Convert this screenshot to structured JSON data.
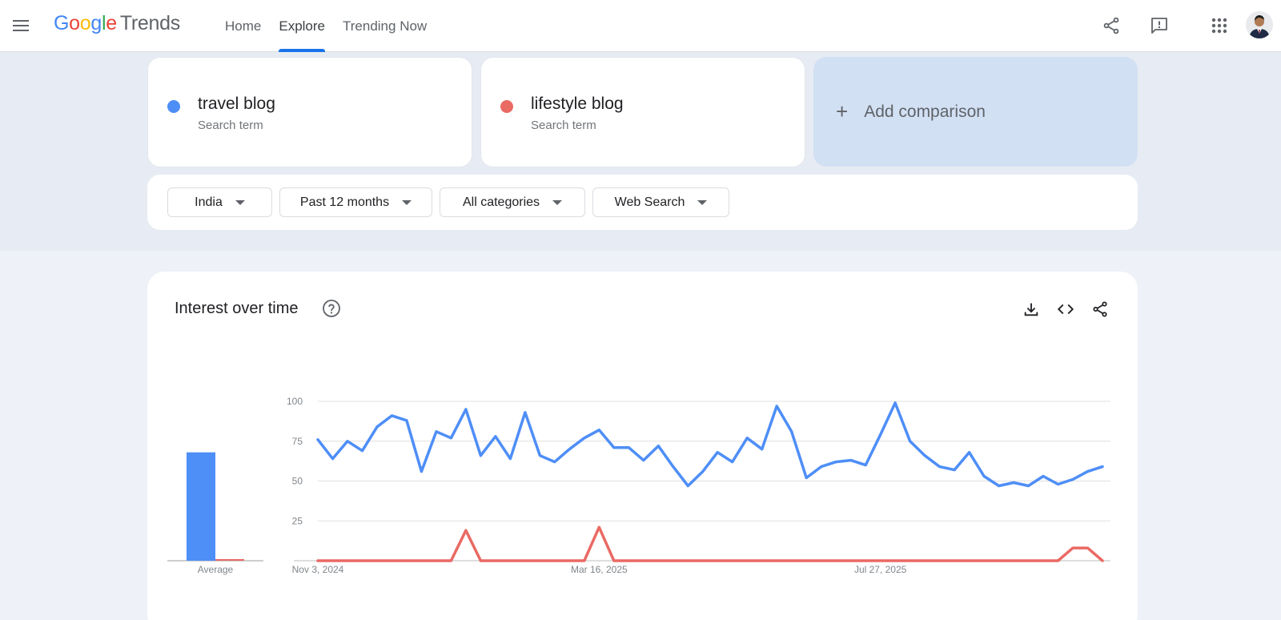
{
  "header": {
    "logo_google": [
      "G",
      "o",
      "o",
      "g",
      "l",
      "e"
    ],
    "logo_trends": "Trends",
    "nav": [
      {
        "label": "Home",
        "active": false
      },
      {
        "label": "Explore",
        "active": true
      },
      {
        "label": "Trending Now",
        "active": false
      }
    ],
    "icons": [
      "menu-icon",
      "share-icon",
      "feedback-icon",
      "apps-icon",
      "avatar"
    ]
  },
  "terms": [
    {
      "name": "travel blog",
      "type": "Search term",
      "color": "#4e8ef7"
    },
    {
      "name": "lifestyle blog",
      "type": "Search term",
      "color": "#ea6a64"
    }
  ],
  "add_comparison": {
    "icon": "+",
    "label": "Add comparison"
  },
  "filters": [
    {
      "label": "India"
    },
    {
      "label": "Past 12 months"
    },
    {
      "label": "All categories"
    },
    {
      "label": "Web Search"
    }
  ],
  "interest": {
    "title": "Interest over time",
    "icons": [
      "help-icon",
      "download-icon",
      "embed-icon",
      "share-icon"
    ]
  },
  "chart_data": {
    "type": "line",
    "title": "Interest over time",
    "ylim": [
      0,
      100
    ],
    "yticks": [
      25,
      50,
      75,
      100
    ],
    "xtick_labels": [
      "Nov 3, 2024",
      "Mar 16, 2025",
      "Jul 27, 2025"
    ],
    "xtick_index": [
      0,
      19,
      38
    ],
    "average_label": "Average",
    "averages": [
      {
        "name": "travel blog",
        "value": 68,
        "color": "#4e8ef7"
      },
      {
        "name": "lifestyle blog",
        "value": 1,
        "color": "#ea6a64"
      }
    ],
    "series": [
      {
        "name": "travel blog",
        "color": "#4e8ef7",
        "values": [
          76,
          64,
          75,
          69,
          84,
          91,
          88,
          56,
          81,
          77,
          95,
          66,
          78,
          64,
          93,
          66,
          62,
          70,
          77,
          82,
          71,
          71,
          63,
          72,
          59,
          47,
          56,
          68,
          62,
          77,
          70,
          97,
          81,
          52,
          59,
          62,
          63,
          60,
          79,
          99,
          75,
          66,
          59,
          57,
          68,
          53,
          47,
          49,
          47,
          53,
          48,
          51,
          56,
          59
        ]
      },
      {
        "name": "lifestyle blog",
        "color": "#ea6a64",
        "values": [
          0,
          0,
          0,
          0,
          0,
          0,
          0,
          0,
          0,
          0,
          19,
          0,
          0,
          0,
          0,
          0,
          0,
          0,
          0,
          21,
          0,
          0,
          0,
          0,
          0,
          0,
          0,
          0,
          0,
          0,
          0,
          0,
          0,
          0,
          0,
          0,
          0,
          0,
          0,
          0,
          0,
          0,
          0,
          0,
          0,
          0,
          0,
          0,
          0,
          0,
          0,
          8,
          8,
          0
        ]
      }
    ]
  }
}
